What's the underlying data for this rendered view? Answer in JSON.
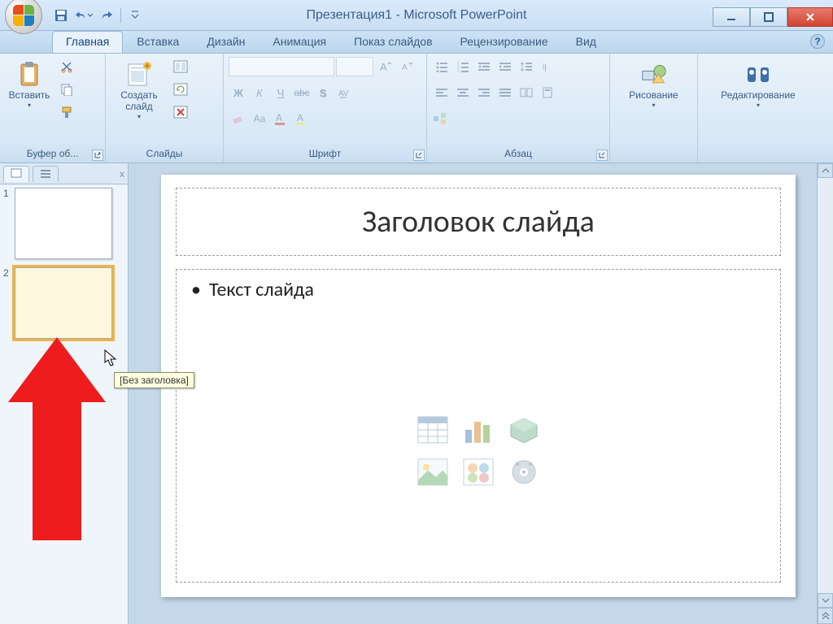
{
  "title": {
    "doc": "Презентация1",
    "app": "Microsoft PowerPoint",
    "separator": " - "
  },
  "qat": {
    "save": "save-icon",
    "undo": "undo-icon",
    "redo": "redo-icon"
  },
  "tabs": [
    "Главная",
    "Вставка",
    "Дизайн",
    "Анимация",
    "Показ слайдов",
    "Рецензирование",
    "Вид"
  ],
  "activeTab": 0,
  "ribbon": {
    "clipboard": {
      "paste": "Вставить",
      "label": "Буфер об..."
    },
    "slides": {
      "newSlide": "Создать слайд",
      "label": "Слайды"
    },
    "font": {
      "label": "Шрифт"
    },
    "para": {
      "label": "Абзац"
    },
    "drawing": {
      "btn": "Рисование",
      "label": ""
    },
    "editing": {
      "btn": "Редактирование",
      "label": ""
    }
  },
  "pane": {
    "thumbs": [
      {
        "n": "1",
        "selected": false
      },
      {
        "n": "2",
        "selected": true
      }
    ],
    "closeSymbol": "x"
  },
  "slide": {
    "titlePlaceholder": "Заголовок слайда",
    "bodyBullet": "Текст слайда"
  },
  "tooltip": "[Без заголовка]",
  "helpSymbol": "?",
  "colors": {
    "accent": "#f5b23a",
    "ribbon": "#e9f2fa",
    "border": "#9bb9d6"
  }
}
